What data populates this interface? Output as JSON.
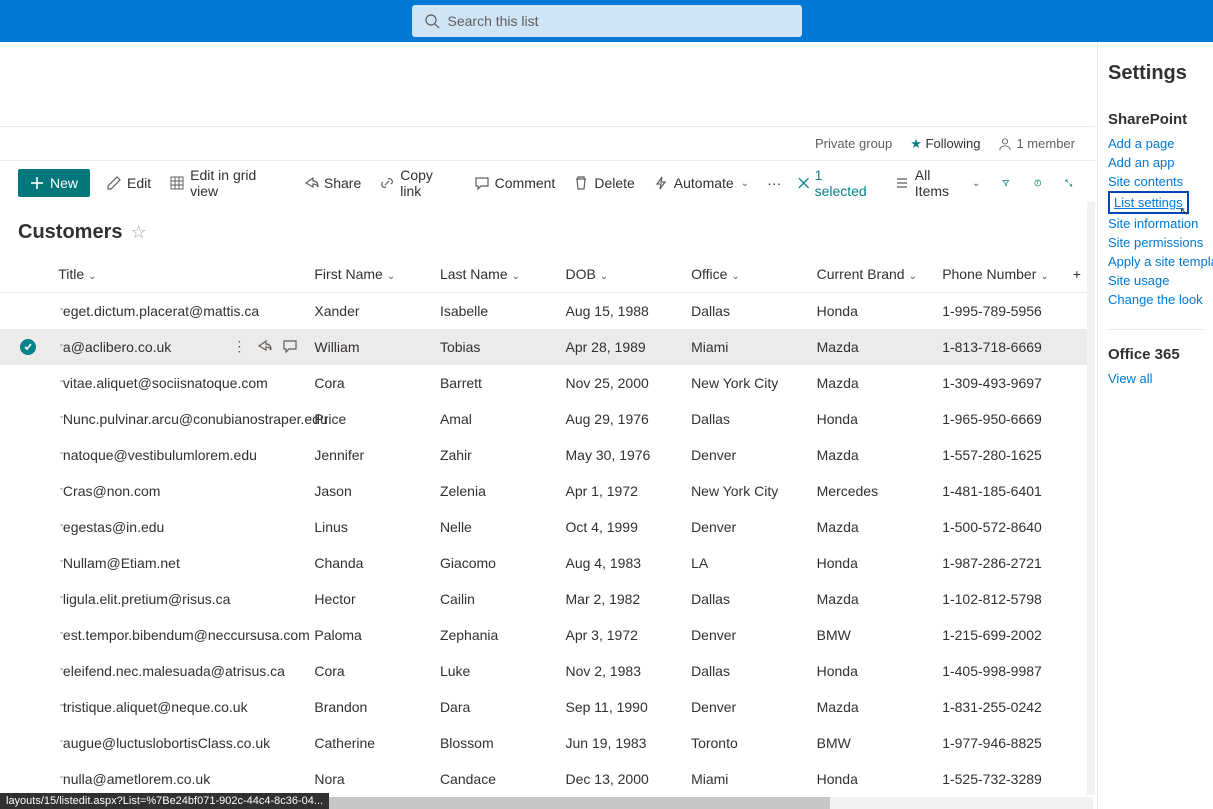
{
  "search": {
    "placeholder": "Search this list"
  },
  "groupInfo": {
    "privacy": "Private group",
    "following": "Following",
    "members": "1 member"
  },
  "cmd": {
    "new": "New",
    "edit": "Edit",
    "editGrid": "Edit in grid view",
    "share": "Share",
    "copyLink": "Copy link",
    "comment": "Comment",
    "delete": "Delete",
    "automate": "Automate",
    "selected": "1 selected",
    "allItems": "All Items"
  },
  "listTitle": "Customers",
  "columns": {
    "title": "Title",
    "firstName": "First Name",
    "lastName": "Last Name",
    "dob": "DOB",
    "office": "Office",
    "brand": "Current Brand",
    "phone": "Phone Number"
  },
  "rows": [
    {
      "email": "eget.dictum.placerat@mattis.ca",
      "fn": "Xander",
      "ln": "Isabelle",
      "dob": "Aug 15, 1988",
      "office": "Dallas",
      "brand": "Honda",
      "phone": "1-995-789-5956",
      "selected": false
    },
    {
      "email": "a@aclibero.co.uk",
      "fn": "William",
      "ln": "Tobias",
      "dob": "Apr 28, 1989",
      "office": "Miami",
      "brand": "Mazda",
      "phone": "1-813-718-6669",
      "selected": true
    },
    {
      "email": "vitae.aliquet@sociisnatoque.com",
      "fn": "Cora",
      "ln": "Barrett",
      "dob": "Nov 25, 2000",
      "office": "New York City",
      "brand": "Mazda",
      "phone": "1-309-493-9697",
      "selected": false
    },
    {
      "email": "Nunc.pulvinar.arcu@conubianostraper.edu",
      "fn": "Price",
      "ln": "Amal",
      "dob": "Aug 29, 1976",
      "office": "Dallas",
      "brand": "Honda",
      "phone": "1-965-950-6669",
      "selected": false
    },
    {
      "email": "natoque@vestibulumlorem.edu",
      "fn": "Jennifer",
      "ln": "Zahir",
      "dob": "May 30, 1976",
      "office": "Denver",
      "brand": "Mazda",
      "phone": "1-557-280-1625",
      "selected": false
    },
    {
      "email": "Cras@non.com",
      "fn": "Jason",
      "ln": "Zelenia",
      "dob": "Apr 1, 1972",
      "office": "New York City",
      "brand": "Mercedes",
      "phone": "1-481-185-6401",
      "selected": false
    },
    {
      "email": "egestas@in.edu",
      "fn": "Linus",
      "ln": "Nelle",
      "dob": "Oct 4, 1999",
      "office": "Denver",
      "brand": "Mazda",
      "phone": "1-500-572-8640",
      "selected": false
    },
    {
      "email": "Nullam@Etiam.net",
      "fn": "Chanda",
      "ln": "Giacomo",
      "dob": "Aug 4, 1983",
      "office": "LA",
      "brand": "Honda",
      "phone": "1-987-286-2721",
      "selected": false
    },
    {
      "email": "ligula.elit.pretium@risus.ca",
      "fn": "Hector",
      "ln": "Cailin",
      "dob": "Mar 2, 1982",
      "office": "Dallas",
      "brand": "Mazda",
      "phone": "1-102-812-5798",
      "selected": false
    },
    {
      "email": "est.tempor.bibendum@neccursusa.com",
      "fn": "Paloma",
      "ln": "Zephania",
      "dob": "Apr 3, 1972",
      "office": "Denver",
      "brand": "BMW",
      "phone": "1-215-699-2002",
      "selected": false
    },
    {
      "email": "eleifend.nec.malesuada@atrisus.ca",
      "fn": "Cora",
      "ln": "Luke",
      "dob": "Nov 2, 1983",
      "office": "Dallas",
      "brand": "Honda",
      "phone": "1-405-998-9987",
      "selected": false
    },
    {
      "email": "tristique.aliquet@neque.co.uk",
      "fn": "Brandon",
      "ln": "Dara",
      "dob": "Sep 11, 1990",
      "office": "Denver",
      "brand": "Mazda",
      "phone": "1-831-255-0242",
      "selected": false
    },
    {
      "email": "augue@luctuslobortisClass.co.uk",
      "fn": "Catherine",
      "ln": "Blossom",
      "dob": "Jun 19, 1983",
      "office": "Toronto",
      "brand": "BMW",
      "phone": "1-977-946-8825",
      "selected": false
    },
    {
      "email": "nulla@ametlorem.co.uk",
      "fn": "Nora",
      "ln": "Candace",
      "dob": "Dec 13, 2000",
      "office": "Miami",
      "brand": "Honda",
      "phone": "1-525-732-3289",
      "selected": false
    }
  ],
  "settings": {
    "title": "Settings",
    "sp": "SharePoint",
    "links": {
      "addPage": "Add a page",
      "addApp": "Add an app",
      "siteContents": "Site contents",
      "listSettings": "List settings",
      "siteInfo": "Site information",
      "sitePerm": "Site permissions",
      "applyTpl": "Apply a site template",
      "siteUsage": "Site usage",
      "changeLook": "Change the look"
    },
    "o365": "Office 365",
    "viewAll": "View all"
  },
  "statusTip": "layouts/15/listedit.aspx?List=%7Be24bf071-902c-44c4-8c36-04..."
}
